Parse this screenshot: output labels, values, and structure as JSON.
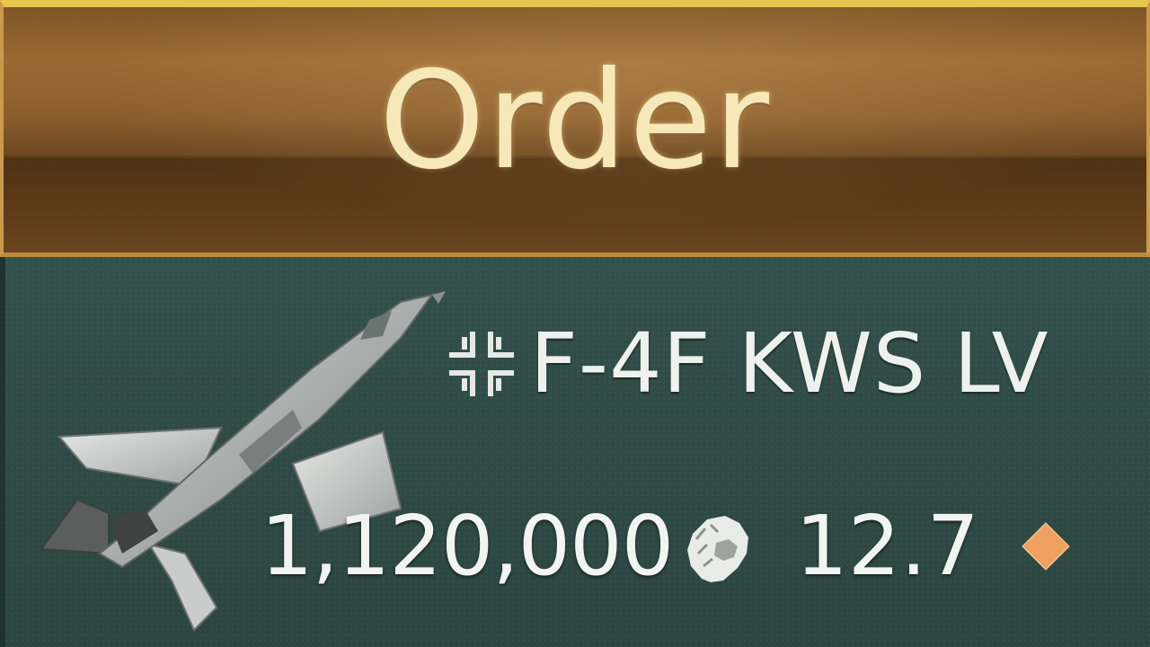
{
  "order_button": {
    "label": "Order"
  },
  "vehicle": {
    "name": "F-4F KWS LV",
    "nation_icon": "balkenkreuz-icon",
    "price": "1,120,000",
    "currency_icon": "lion-icon",
    "battle_rating": "12.7",
    "rank_icon": "diamond-icon"
  },
  "colors": {
    "button_gold": "#e8c54c",
    "button_text": "#f6e8b8",
    "card_bg": "#2e4540",
    "diamond": "#f0a060",
    "text": "#eef1ee"
  }
}
